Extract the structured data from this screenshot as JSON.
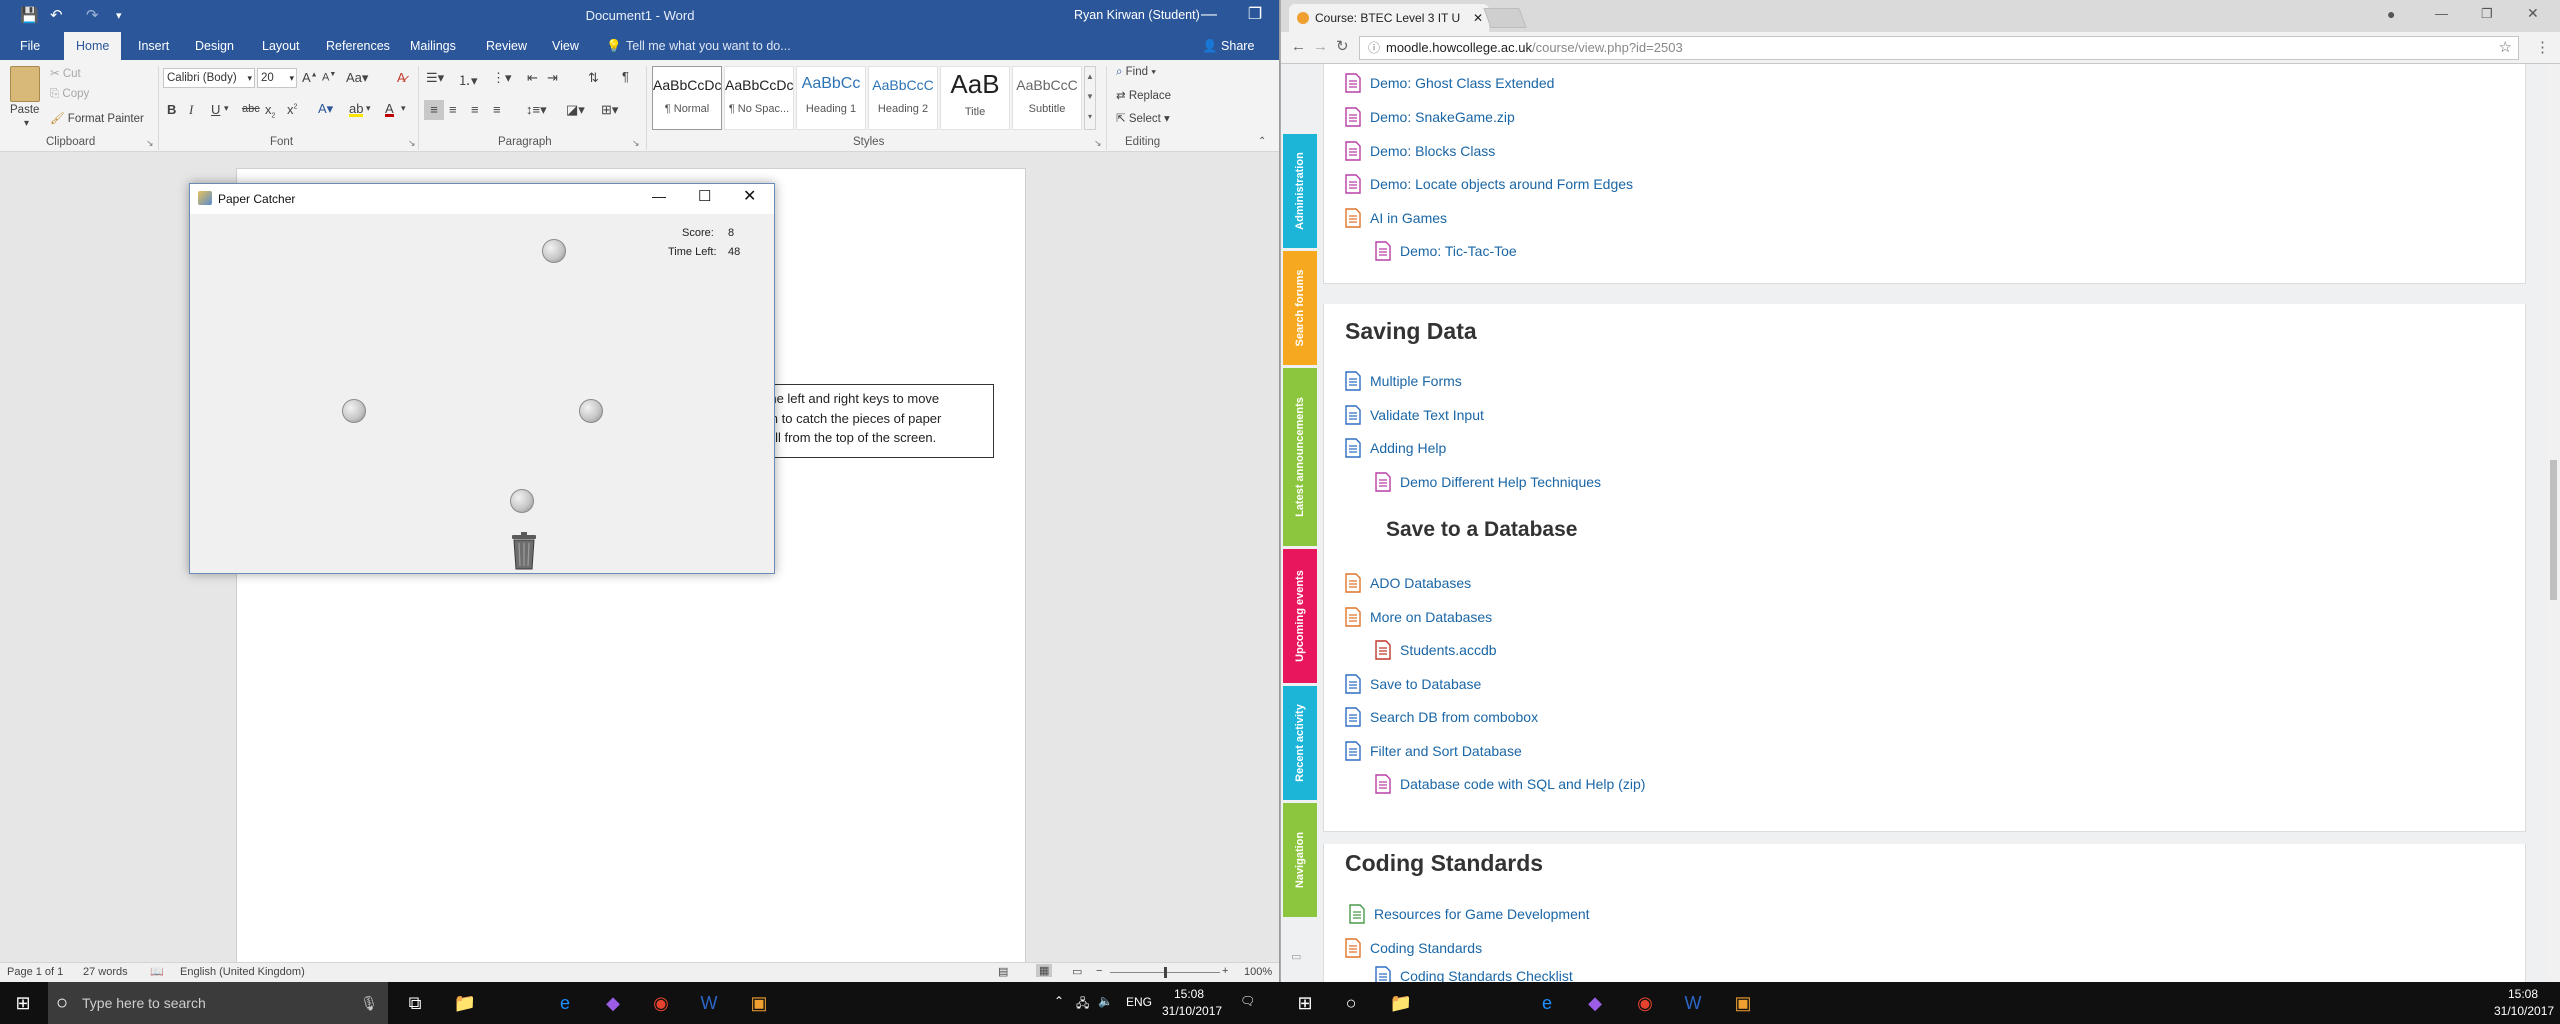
{
  "word": {
    "window_title": "Document1 - Word",
    "user": "Ryan Kirwan (Student)",
    "share": "Share",
    "tabs": [
      "File",
      "Home",
      "Insert",
      "Design",
      "Layout",
      "References",
      "Mailings",
      "Review",
      "View"
    ],
    "tell_me": "Tell me what you want to do...",
    "clipboard": {
      "paste": "Paste",
      "cut": "Cut",
      "copy": "Copy",
      "format_painter": "Format Painter",
      "label": "Clipboard"
    },
    "font": {
      "name": "Calibri (Body)",
      "size": "20",
      "label": "Font"
    },
    "paragraph_label": "Paragraph",
    "styles": {
      "label": "Styles",
      "items": [
        {
          "sample": "AaBbCcDc",
          "name": "¶ Normal"
        },
        {
          "sample": "AaBbCcDc",
          "name": "¶ No Spac..."
        },
        {
          "sample": "AaBbCc",
          "name": "Heading 1"
        },
        {
          "sample": "AaBbCcC",
          "name": "Heading 2"
        },
        {
          "sample": "AaB",
          "name": "Title"
        },
        {
          "sample": "AaBbCcC",
          "name": "Subtitle"
        }
      ]
    },
    "editing": {
      "find": "Find",
      "replace": "Replace",
      "select": "Select",
      "label": "Editing"
    },
    "textbox_lines": [
      "Use the left and right keys to move",
      "the bin to catch the pieces of paper",
      "that fall from the top of the screen."
    ],
    "status": {
      "page": "Page 1 of 1",
      "words": "27 words",
      "language": "English (United Kingdom)",
      "zoom": "100%"
    }
  },
  "paper_catcher": {
    "title": "Paper Catcher",
    "score_label": "Score:",
    "score": "8",
    "time_label": "Time Left:",
    "time_left": "48"
  },
  "taskbar": {
    "search_placeholder": "Type here to search",
    "lang": "ENG",
    "time": "15:08",
    "date": "31/10/2017"
  },
  "chrome": {
    "tab_title": "Course: BTEC Level 3 IT U",
    "url_host": "moodle.howcollege.ac.uk",
    "url_path": "/course/view.php?id=2503",
    "block_tabs": [
      "Administration",
      "Search forums",
      "Latest announcements",
      "Upcoming events",
      "Recent activity",
      "Navigation"
    ],
    "top_links": [
      "Demo: Ghost Class Extended",
      "Demo: SnakeGame.zip",
      "Demo: Blocks Class",
      "Demo: Locate objects around Form Edges",
      "AI in Games",
      "Demo: Tic-Tac-Toe"
    ],
    "saving_data": {
      "title": "Saving Data",
      "links": [
        "Multiple Forms",
        "Validate Text Input",
        "Adding Help",
        "Demo Different Help Techniques"
      ],
      "subtitle": "Save to a Database",
      "db_links": [
        "ADO Databases",
        "More on Databases",
        "Students.accdb",
        "Save to Database",
        "Search DB from combobox",
        "Filter and Sort Database",
        "Database code with SQL and Help (zip)"
      ]
    },
    "coding": {
      "title": "Coding Standards",
      "links": [
        "Resources for Game Development",
        "Coding Standards",
        "Coding Standards Checklist"
      ]
    }
  },
  "colors": {
    "word_blue": "#2b579a",
    "link_blue": "#1a66a6"
  }
}
